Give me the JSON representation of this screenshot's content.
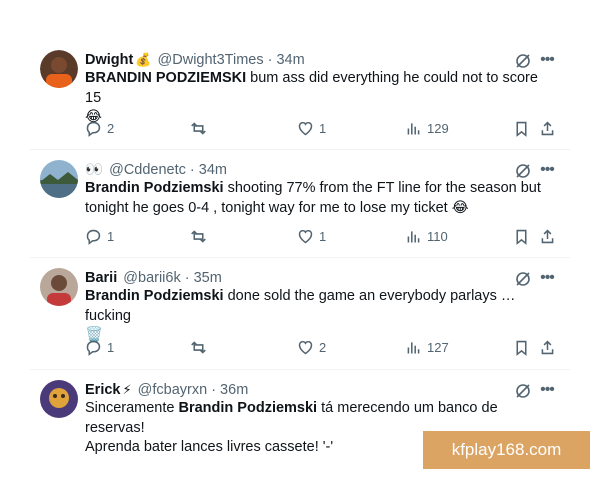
{
  "colors": {
    "text": "#0f1419",
    "meta": "#536471",
    "divider": "#eff3f4",
    "watermark_bg": "#dca463"
  },
  "tweets": [
    {
      "display_name": "Dwight",
      "name_emoji": "💰",
      "meta": "@Dwight3Times · 34m",
      "bold": "BRANDIN PODZIEMSKI",
      "before": "",
      "after": " bum ass did everything he could not to score 15",
      "line2": "😂",
      "replies": "2",
      "reposts": "",
      "likes": "1",
      "views": "129",
      "avatar": "avatar-orange-jersey"
    },
    {
      "display_name": "👀",
      "name_emoji": "",
      "meta": "@Cddenetc · 34m",
      "bold": "Brandin Podziemski",
      "before": "",
      "after": " shooting 77% from the FT line for the season but",
      "line2": "tonight he goes 0-4 , tonight way for me to lose my ticket 😂",
      "replies": "1",
      "reposts": "",
      "likes": "1",
      "views": "110",
      "avatar": "avatar-lake-landscape"
    },
    {
      "display_name": "Barii",
      "name_emoji": "",
      "meta": "@barii6k · 35m",
      "bold": "Brandin Podziemski",
      "before": "",
      "after": " done sold the game an everybody parlays … fucking",
      "line2": "🗑️",
      "replies": "1",
      "reposts": "",
      "likes": "2",
      "views": "127",
      "avatar": "avatar-person"
    },
    {
      "display_name": "Erick",
      "name_emoji": "⚡",
      "meta": "@fcbayrxn · 36m",
      "bold": "Brandin Podziemski",
      "before": "Sinceramente ",
      "after": " tá merecendo um banco de reservas!",
      "line2": "Aprenda bater lances livres cassete! '-'",
      "avatar": "avatar-cartoon"
    }
  ],
  "watermark": "kfplay168.com"
}
